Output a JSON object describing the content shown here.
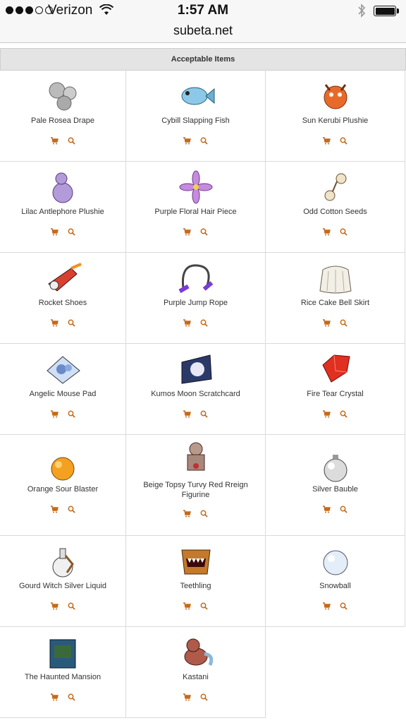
{
  "status": {
    "carrier": "Verizon",
    "time": "1:57 AM"
  },
  "browser": {
    "url": "subeta.net"
  },
  "table": {
    "header": "Acceptable Items",
    "items": [
      {
        "name": "Pale Rosea Drape",
        "icon": "grey-roses"
      },
      {
        "name": "Cybill Slapping Fish",
        "icon": "blue-fish"
      },
      {
        "name": "Sun Kerubi Plushie",
        "icon": "orange-plushie"
      },
      {
        "name": "Lilac Antlephore Plushie",
        "icon": "purple-plushie"
      },
      {
        "name": "Purple Floral Hair Piece",
        "icon": "purple-flower"
      },
      {
        "name": "Odd Cotton Seeds",
        "icon": "cotton-seeds"
      },
      {
        "name": "Rocket Shoes",
        "icon": "rocket-shoes"
      },
      {
        "name": "Purple Jump Rope",
        "icon": "jump-rope"
      },
      {
        "name": "Rice Cake Bell Skirt",
        "icon": "white-skirt"
      },
      {
        "name": "Angelic Mouse Pad",
        "icon": "mouse-pad"
      },
      {
        "name": "Kumos Moon Scratchcard",
        "icon": "scratchcard"
      },
      {
        "name": "Fire Tear Crystal",
        "icon": "red-crystal"
      },
      {
        "name": "Orange Sour Blaster",
        "icon": "orange-candy"
      },
      {
        "name": "Beige Topsy Turvy Red Rreign Figurine",
        "icon": "figurine"
      },
      {
        "name": "Silver Bauble",
        "icon": "silver-bauble"
      },
      {
        "name": "Gourd Witch Silver Liquid",
        "icon": "potion-bottle"
      },
      {
        "name": "Teethling",
        "icon": "teeth-creature"
      },
      {
        "name": "Snowball",
        "icon": "snowball"
      },
      {
        "name": "The Haunted Mansion",
        "icon": "blue-book"
      },
      {
        "name": "Kastani",
        "icon": "kastani-pet"
      }
    ]
  },
  "colors": {
    "accent": "#c46a1a",
    "header_bg": "#e4e4e4"
  }
}
